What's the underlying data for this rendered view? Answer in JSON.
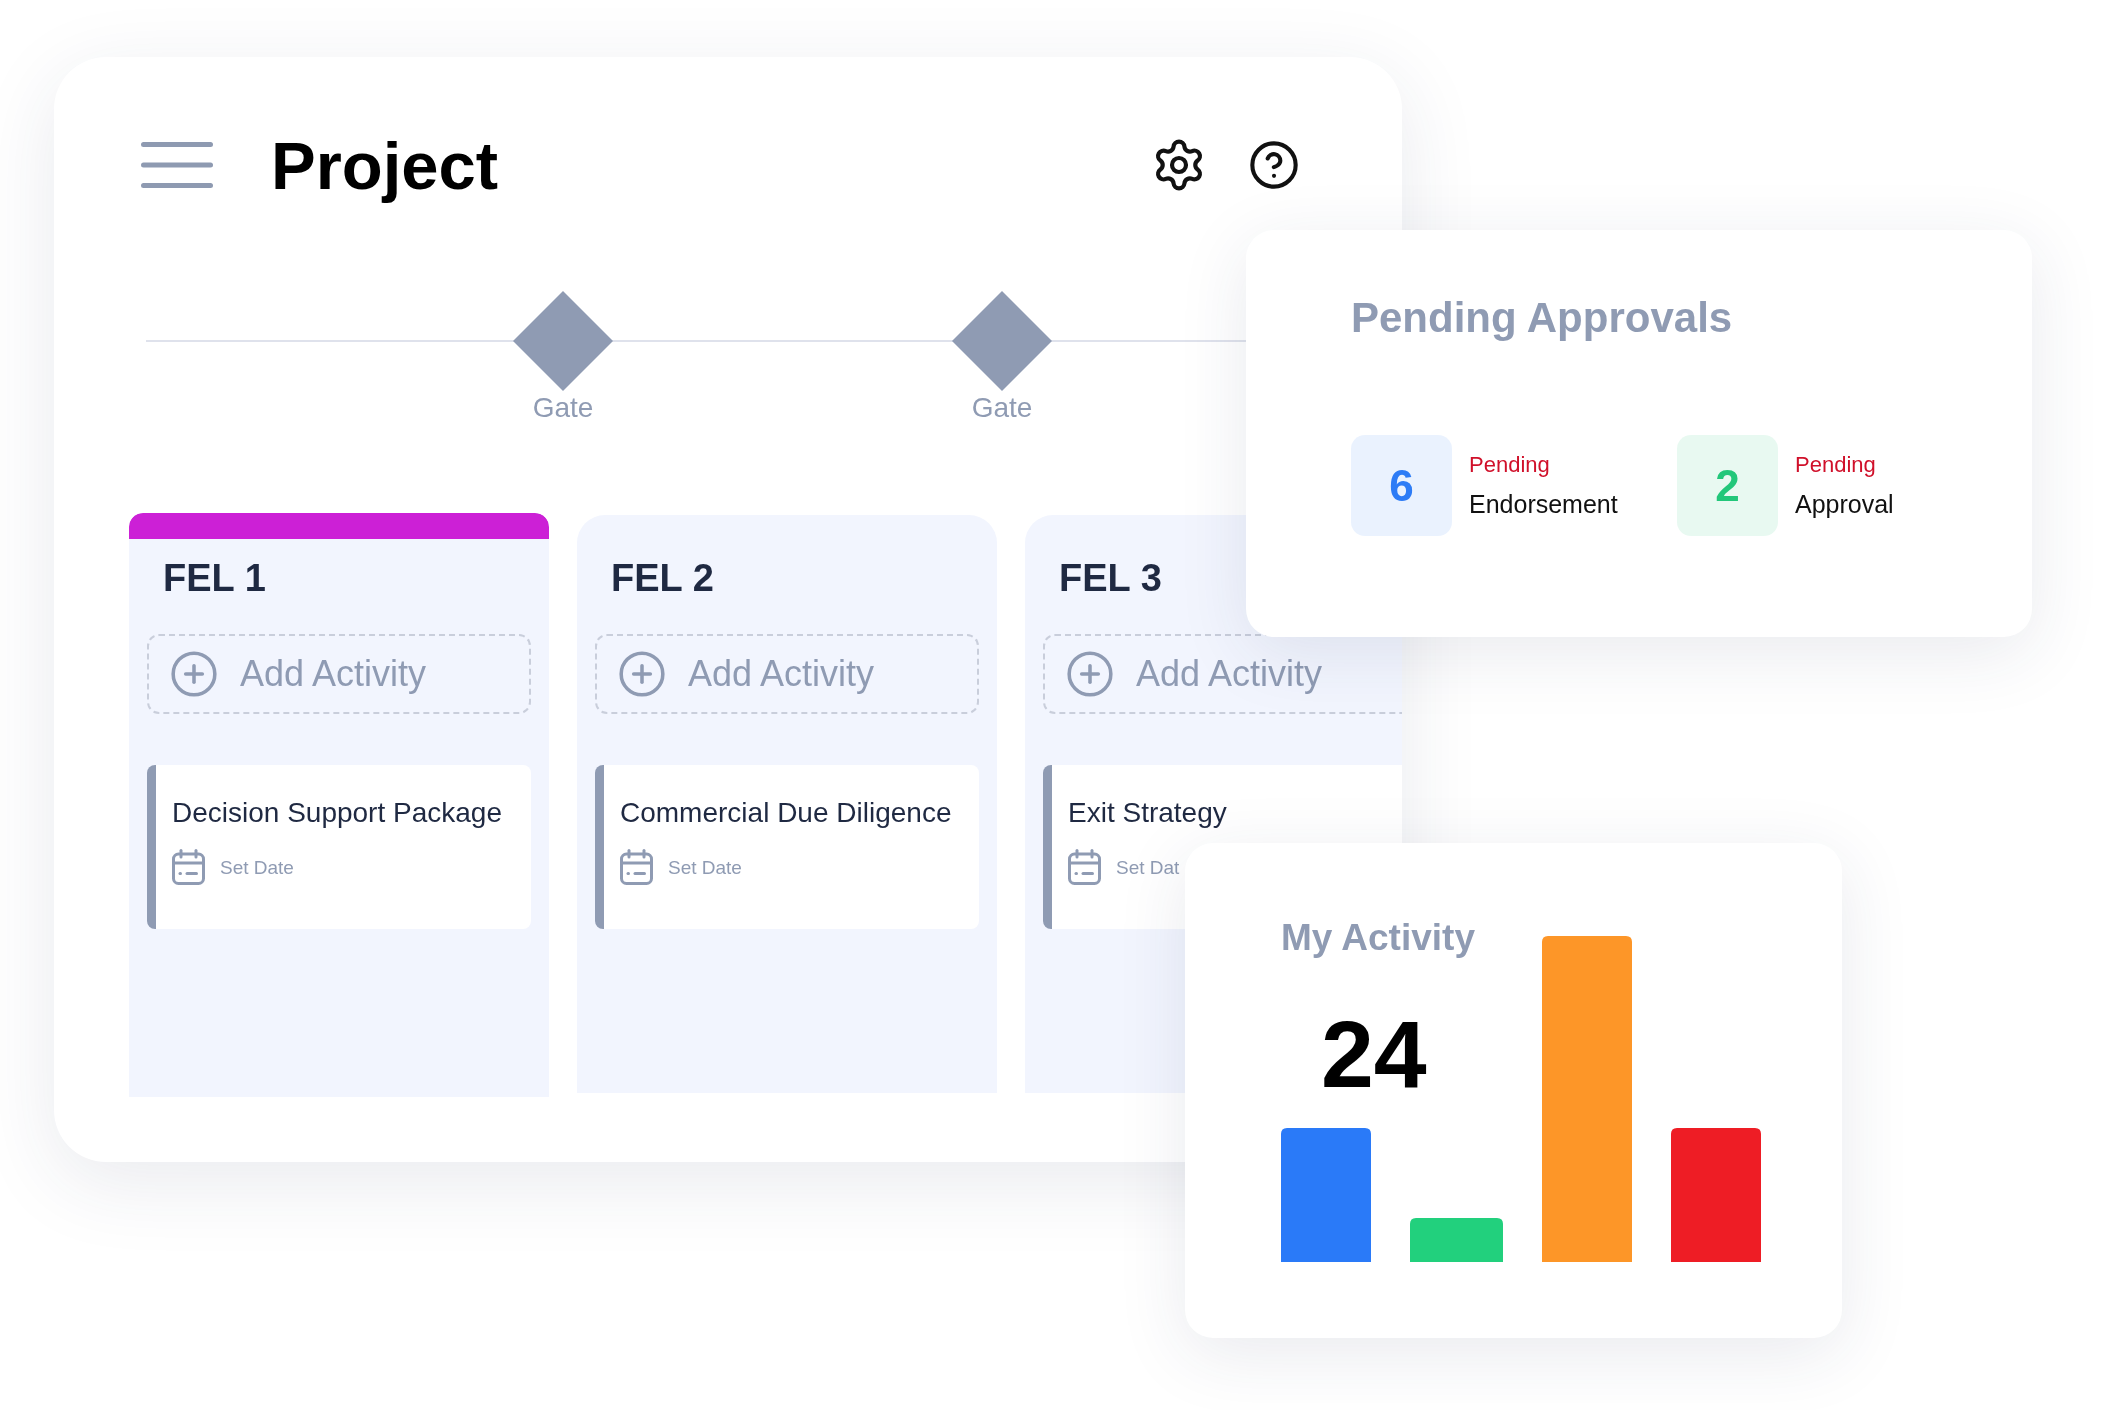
{
  "project": {
    "title": "Project",
    "gates": [
      {
        "label": "Gate"
      },
      {
        "label": "Gate"
      }
    ],
    "phases": [
      {
        "title": "FEL 1",
        "selected": true,
        "add_label": "Add Activity",
        "activities": [
          {
            "title": "Decision Support Package",
            "date_label": "Set Date"
          }
        ]
      },
      {
        "title": "FEL 2",
        "selected": false,
        "add_label": "Add Activity",
        "activities": [
          {
            "title": "Commercial Due Diligence",
            "date_label": "Set Date"
          }
        ]
      },
      {
        "title": "FEL 3",
        "selected": false,
        "add_label": "Add Activity",
        "activities": [
          {
            "title": "Exit Strategy",
            "date_label": "Set Dat"
          }
        ]
      }
    ]
  },
  "pending_approvals": {
    "title": "Pending Approvals",
    "items": [
      {
        "count": "6",
        "status": "Pending",
        "label": "Endorsement",
        "color": "#2d7cf6"
      },
      {
        "count": "2",
        "status": "Pending",
        "label": "Approval",
        "color": "#22c77a"
      }
    ]
  },
  "my_activity": {
    "title": "My Activity",
    "total": "24"
  }
}
